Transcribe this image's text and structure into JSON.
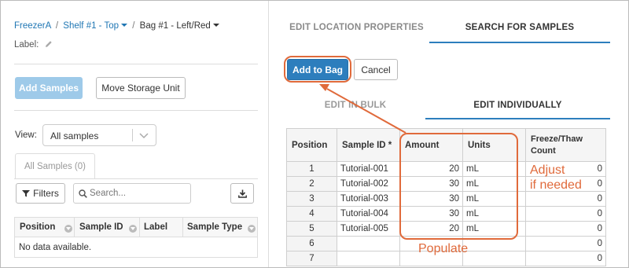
{
  "breadcrumb": {
    "freezer": "FreezerA",
    "sep1": "/",
    "shelf": "Shelf #1 - Top",
    "sep2": "/",
    "bag": "Bag #1 - Left/Red"
  },
  "label_field": {
    "label": "Label:"
  },
  "left_panel": {
    "add_samples": "Add Samples",
    "move_storage_unit": "Move Storage Unit",
    "view_label": "View:",
    "view_value": "All samples",
    "subtab": "All Samples (0)",
    "filters_button": "Filters",
    "search_placeholder": "Search...",
    "columns": [
      "Position",
      "Sample ID",
      "Label",
      "Sample Type"
    ],
    "empty_message": "No data available."
  },
  "right_panel": {
    "tabs": [
      "EDIT LOCATION PROPERTIES",
      "SEARCH FOR SAMPLES"
    ],
    "active_tab": "SEARCH FOR SAMPLES",
    "add_to_bag": "Add to Bag",
    "cancel": "Cancel",
    "edit_tabs": [
      "EDIT IN BULK",
      "EDIT INDIVIDUALLY"
    ],
    "active_edit_tab": "EDIT INDIVIDUALLY",
    "grid": {
      "headers": [
        "Position",
        "Sample ID *",
        "Amount",
        "Units",
        "Freeze/Thaw\nCount"
      ],
      "header_freeze_line1": "Freeze/Thaw",
      "header_freeze_line2": "Count",
      "rows": [
        {
          "position": "1",
          "sample_id": "Tutorial-001",
          "amount": "20",
          "units": "mL",
          "freeze": "0"
        },
        {
          "position": "2",
          "sample_id": "Tutorial-002",
          "amount": "30",
          "units": "mL",
          "freeze": "0"
        },
        {
          "position": "3",
          "sample_id": "Tutorial-003",
          "amount": "30",
          "units": "mL",
          "freeze": "0"
        },
        {
          "position": "4",
          "sample_id": "Tutorial-004",
          "amount": "30",
          "units": "mL",
          "freeze": "0"
        },
        {
          "position": "5",
          "sample_id": "Tutorial-005",
          "amount": "20",
          "units": "mL",
          "freeze": "0"
        },
        {
          "position": "6",
          "sample_id": "",
          "amount": "",
          "units": "",
          "freeze": "0"
        },
        {
          "position": "7",
          "sample_id": "",
          "amount": "",
          "units": "",
          "freeze": "0"
        }
      ]
    }
  },
  "annotations": {
    "adjust_line1": "Adjust",
    "adjust_line2": "if needed",
    "populate": "Populate",
    "color": "#e06a3b"
  },
  "colors": {
    "primary": "#2d7ebd",
    "link": "#2077b4",
    "annotation": "#e06a3b"
  }
}
